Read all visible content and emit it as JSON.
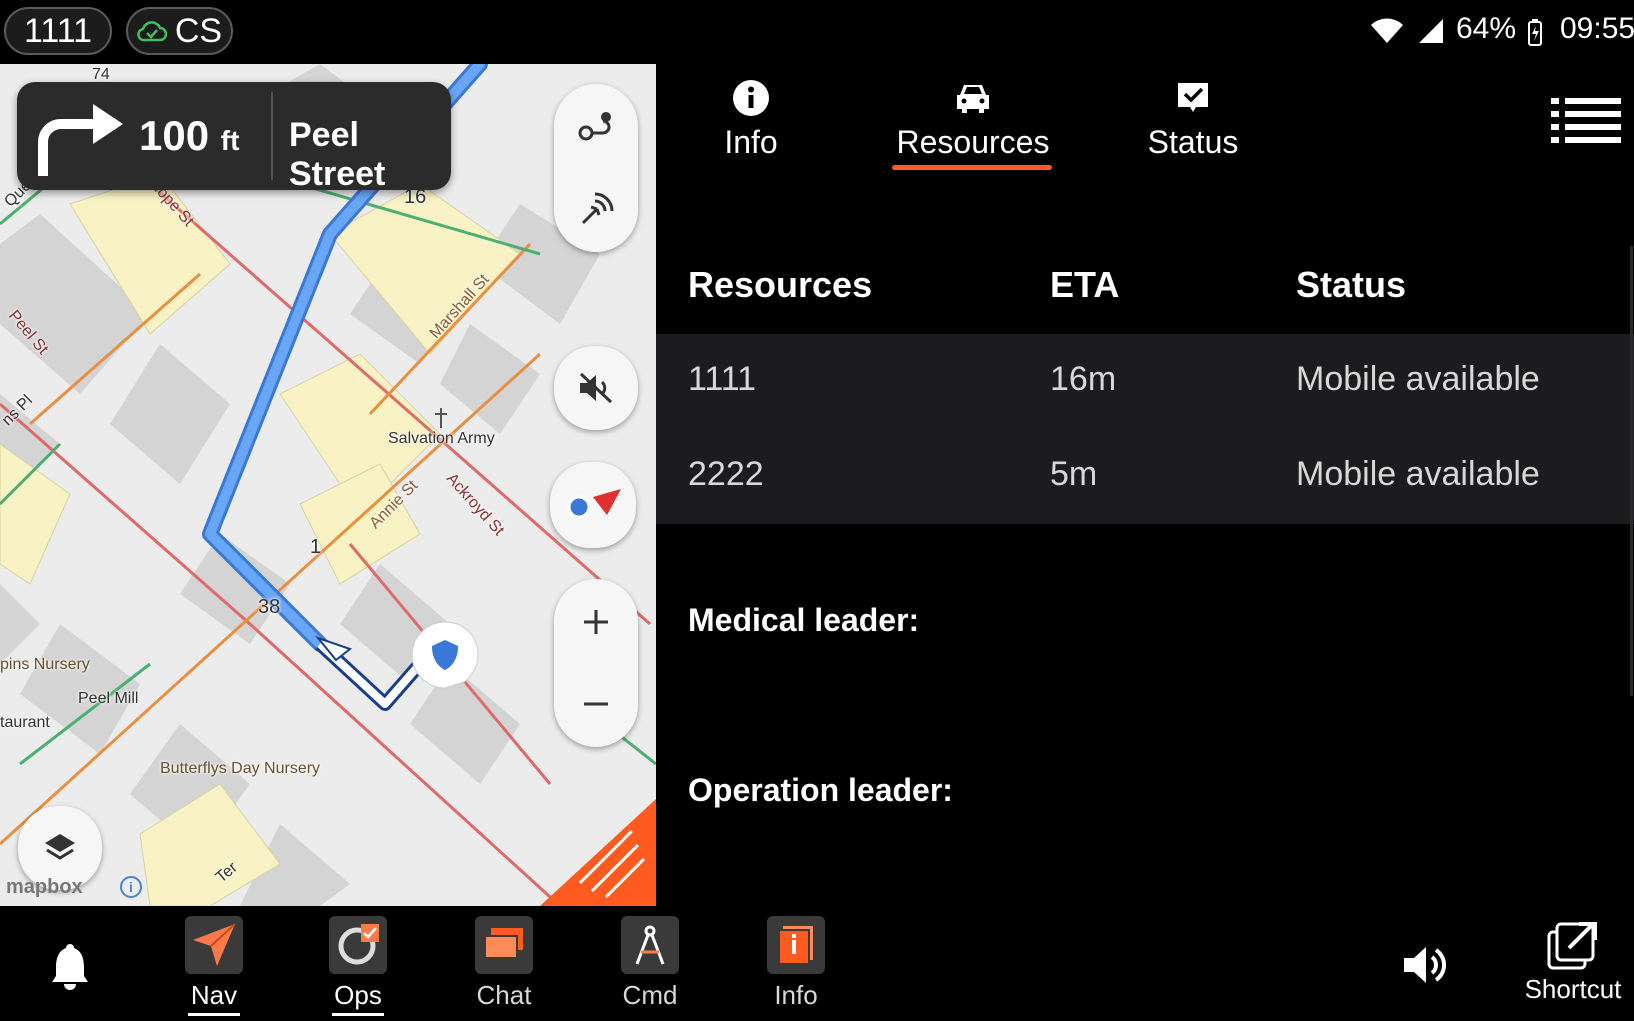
{
  "status_bar": {
    "unit_id": "1111",
    "sync_label": "CS",
    "battery": "64%",
    "time": "09:55"
  },
  "map": {
    "turn_distance": "100",
    "turn_unit": "ft",
    "street_name": "Peel Street",
    "labels": [
      "74",
      "16",
      "Quee",
      "Hope St",
      "Peel St",
      "Marshall St",
      "Salvation Army",
      "Annie St",
      "Ackroyd St",
      "1",
      "38",
      "ns Pl",
      "pins Nursery",
      "Peel Mill",
      "taurant",
      "Butterflys Day Nursery",
      "Ter"
    ],
    "attribution": "mapbox"
  },
  "tabs": [
    {
      "label": "Info",
      "icon": "info-icon"
    },
    {
      "label": "Resources",
      "icon": "car-icon",
      "active": true
    },
    {
      "label": "Status",
      "icon": "check-icon"
    }
  ],
  "table": {
    "headers": [
      "Resources",
      "ETA",
      "Status"
    ],
    "rows": [
      [
        "1111",
        "16m",
        "Mobile available"
      ],
      [
        "2222",
        "5m",
        "Mobile available"
      ]
    ]
  },
  "leaders": {
    "medical": "Medical leader:",
    "operation": "Operation leader:"
  },
  "bottom_nav": {
    "items": [
      {
        "label": "Nav",
        "icon": "navigation-arrow-icon",
        "active": true
      },
      {
        "label": "Ops",
        "icon": "ops-icon",
        "active": true
      },
      {
        "label": "Chat",
        "icon": "chat-icon"
      },
      {
        "label": "Cmd",
        "icon": "compass-icon"
      },
      {
        "label": "Info",
        "icon": "info-book-icon"
      }
    ],
    "shortcut_label": "Shortcut"
  },
  "colors": {
    "accent": "#ff5a1f",
    "route": "#4a8ef0",
    "panel_row": "#1c1c1e"
  }
}
